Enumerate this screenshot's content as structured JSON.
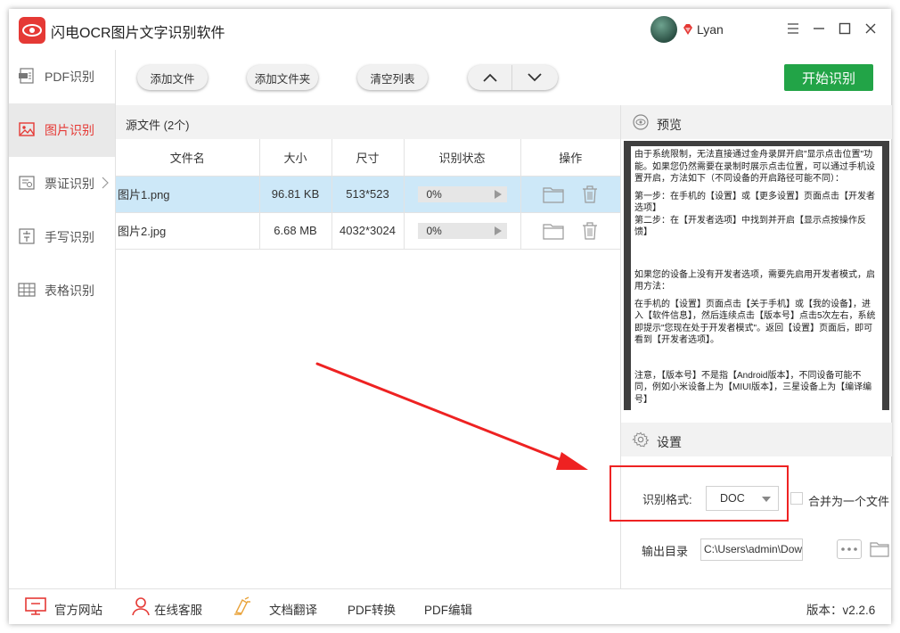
{
  "app": {
    "title": "闪电OCR图片文字识别软件",
    "username": "Lyan"
  },
  "sidebar": {
    "items": [
      {
        "label": "PDF识别",
        "icon": "pdf-icon",
        "active": false
      },
      {
        "label": "图片识别",
        "icon": "image-icon",
        "active": true
      },
      {
        "label": "票证识别",
        "icon": "ticket-icon",
        "active": false,
        "has_submenu": true
      },
      {
        "label": "手写识别",
        "icon": "handwriting-icon",
        "active": false
      },
      {
        "label": "表格识别",
        "icon": "table-icon",
        "active": false
      }
    ]
  },
  "toolbar": {
    "add_file": "添加文件",
    "add_folder": "添加文件夹",
    "clear_list": "清空列表",
    "start": "开始识别"
  },
  "files": {
    "header": "源文件 (2个)",
    "columns": [
      "文件名",
      "大小",
      "尺寸",
      "识别状态",
      "操作"
    ],
    "rows": [
      {
        "name": "图片1.png",
        "size": "96.81 KB",
        "dimensions": "513*523",
        "progress": "0%",
        "selected": true
      },
      {
        "name": "图片2.jpg",
        "size": "6.68 MB",
        "dimensions": "4032*3024",
        "progress": "0%",
        "selected": false
      }
    ]
  },
  "preview": {
    "title": "预览",
    "paragraphs": [
      "由于系统限制，无法直接通过金舟录屏开启\"显示点击位置\"功能。如果您仍然需要在录制时展示点击位置，可以通过手机设置开启，方法如下（不同设备的开启路径可能不同）：",
      "第一步：在手机的【设置】或【更多设置】页面点击【开发者选项】",
      "第二步：在【开发者选项】中找到并开启【显示点按操作反馈】",
      "如果您的设备上没有开发者选项，需要先启用开发者模式，启用方法：",
      "在手机的【设置】页面点击【关于手机】或【我的设备】，进入【软件信息】，然后连续点击【版本号】点击5次左右，系统即提示\"您现在处于开发者模式\"。返回【设置】页面后，即可看到【开发者选项】。",
      "注意，【版本号】不是指【Android版本】，不同设备可能不同，例如小米设备上为【MIUI版本】，三星设备上为【编译编号】"
    ]
  },
  "settings": {
    "title": "设置",
    "format_label": "识别格式:",
    "format_value": "DOC",
    "merge_label": "合并为一个文件",
    "merge_checked": false,
    "output_label": "输出目录",
    "output_path": "C:\\Users\\admin\\Downlo"
  },
  "bottombar": {
    "website": "官方网站",
    "support": "在线客服",
    "translate": "文档翻译",
    "pdf_convert": "PDF转换",
    "pdf_edit": "PDF编辑",
    "version": "版本：v2.2.6"
  },
  "colors": {
    "brand_red": "#e53935",
    "start_green": "#22a447",
    "selected_row": "#cde8f8",
    "annotation_red": "#ee2222"
  }
}
